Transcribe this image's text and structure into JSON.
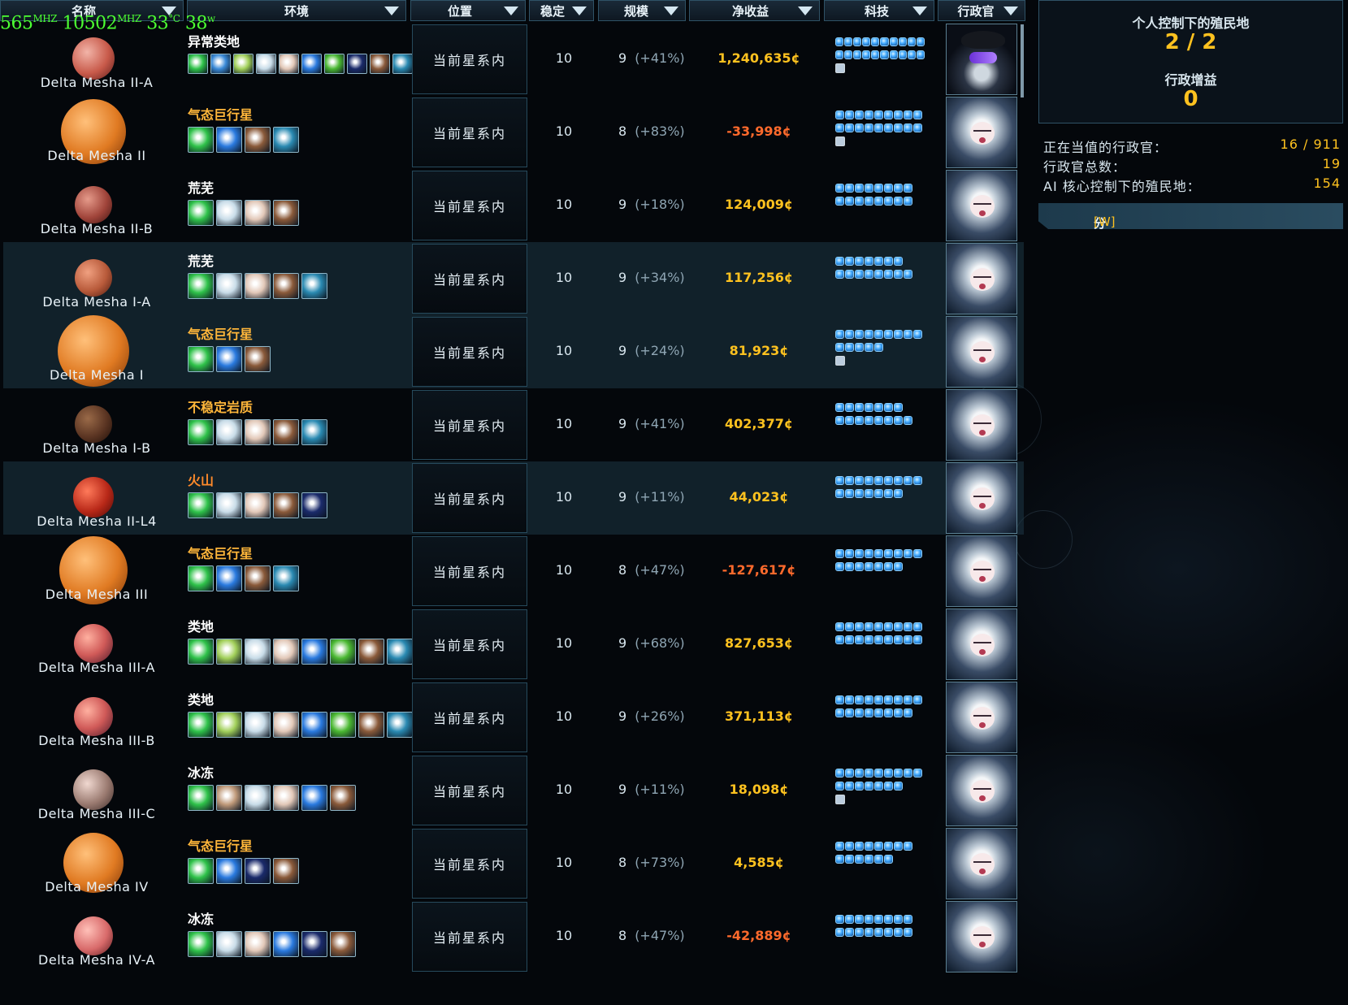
{
  "overlay_stats": {
    "cpu_mhz": "565",
    "mhz_unit": "MHZ",
    "gpu_mhz": "10502",
    "temp": "33",
    "temp_unit": "°C",
    "power": "38",
    "power_unit": "w"
  },
  "columns": {
    "name": "名称",
    "env": "环境",
    "location": "位置",
    "stability": "稳定",
    "size": "规模",
    "income": "净收益",
    "tech": "科技",
    "admin": "行政官"
  },
  "rows": [
    {
      "name": "Delta Mesha II-A",
      "env": "异常类地",
      "env_color": "#ffffff",
      "location": "当前星系内",
      "stability": "10",
      "size": "9",
      "size_pct": "(+41%)",
      "income": "1,240,635¢",
      "income_sign": "pos",
      "highlight": false,
      "admin_type": "general"
    },
    {
      "name": "Delta Mesha II",
      "env": "气态巨行星",
      "env_color": "#ffb63a",
      "location": "当前星系内",
      "stability": "10",
      "size": "8",
      "size_pct": "(+83%)",
      "income": "-33,998¢",
      "income_sign": "neg",
      "highlight": false,
      "admin_type": "girl"
    },
    {
      "name": "Delta Mesha II-B",
      "env": "荒芜",
      "env_color": "#ffffff",
      "location": "当前星系内",
      "stability": "10",
      "size": "9",
      "size_pct": "(+18%)",
      "income": "124,009¢",
      "income_sign": "pos",
      "highlight": false,
      "admin_type": "girl"
    },
    {
      "name": "Delta Mesha I-A",
      "env": "荒芜",
      "env_color": "#ffffff",
      "location": "当前星系内",
      "stability": "10",
      "size": "9",
      "size_pct": "(+34%)",
      "income": "117,256¢",
      "income_sign": "pos",
      "highlight": true,
      "admin_type": "girl"
    },
    {
      "name": "Delta Mesha I",
      "env": "气态巨行星",
      "env_color": "#ffb63a",
      "location": "当前星系内",
      "stability": "10",
      "size": "9",
      "size_pct": "(+24%)",
      "income": "81,923¢",
      "income_sign": "pos",
      "highlight": true,
      "admin_type": "girl"
    },
    {
      "name": "Delta Mesha I-B",
      "env": "不稳定岩质",
      "env_color": "#ffb63a",
      "location": "当前星系内",
      "stability": "10",
      "size": "9",
      "size_pct": "(+41%)",
      "income": "402,377¢",
      "income_sign": "pos",
      "highlight": false,
      "admin_type": "girl"
    },
    {
      "name": "Delta Mesha II-L4",
      "env": "火山",
      "env_color": "#ff8a2a",
      "location": "当前星系内",
      "stability": "10",
      "size": "9",
      "size_pct": "(+11%)",
      "income": "44,023¢",
      "income_sign": "pos",
      "highlight": true,
      "admin_type": "girl"
    },
    {
      "name": "Delta Mesha III",
      "env": "气态巨行星",
      "env_color": "#ffb63a",
      "location": "当前星系内",
      "stability": "10",
      "size": "8",
      "size_pct": "(+47%)",
      "income": "-127,617¢",
      "income_sign": "neg",
      "highlight": false,
      "admin_type": "girl"
    },
    {
      "name": "Delta Mesha III-A",
      "env": "类地",
      "env_color": "#ffffff",
      "location": "当前星系内",
      "stability": "10",
      "size": "9",
      "size_pct": "(+68%)",
      "income": "827,653¢",
      "income_sign": "pos",
      "highlight": false,
      "admin_type": "girl"
    },
    {
      "name": "Delta Mesha III-B",
      "env": "类地",
      "env_color": "#ffffff",
      "location": "当前星系内",
      "stability": "10",
      "size": "9",
      "size_pct": "(+26%)",
      "income": "371,113¢",
      "income_sign": "pos",
      "highlight": false,
      "admin_type": "girl"
    },
    {
      "name": "Delta Mesha III-C",
      "env": "冰冻",
      "env_color": "#ffffff",
      "location": "当前星系内",
      "stability": "10",
      "size": "9",
      "size_pct": "(+11%)",
      "income": "18,098¢",
      "income_sign": "pos",
      "highlight": false,
      "admin_type": "girl"
    },
    {
      "name": "Delta Mesha IV",
      "env": "气态巨行星",
      "env_color": "#ffb63a",
      "location": "当前星系内",
      "stability": "10",
      "size": "8",
      "size_pct": "(+73%)",
      "income": "4,585¢",
      "income_sign": "pos",
      "highlight": false,
      "admin_type": "girl"
    },
    {
      "name": "Delta Mesha IV-A",
      "env": "冰冻",
      "env_color": "#ffffff",
      "location": "当前星系内",
      "stability": "10",
      "size": "8",
      "size_pct": "(+47%)",
      "income": "-42,889¢",
      "income_sign": "neg",
      "highlight": false,
      "admin_type": "girl"
    }
  ],
  "panel": {
    "title": "个人控制下的殖民地",
    "count": "2 / 2",
    "bonus_label": "行政增益",
    "bonus_value": "0"
  },
  "info": [
    {
      "label": "正在当值的行政官：",
      "value": "16 / 911"
    },
    {
      "label": "行政官总数：",
      "value": "19"
    },
    {
      "label": "AI 核心控制下的殖民地：",
      "value": "154"
    }
  ],
  "assign_button": {
    "label": "分配行政官",
    "hotkey": "[W]"
  }
}
